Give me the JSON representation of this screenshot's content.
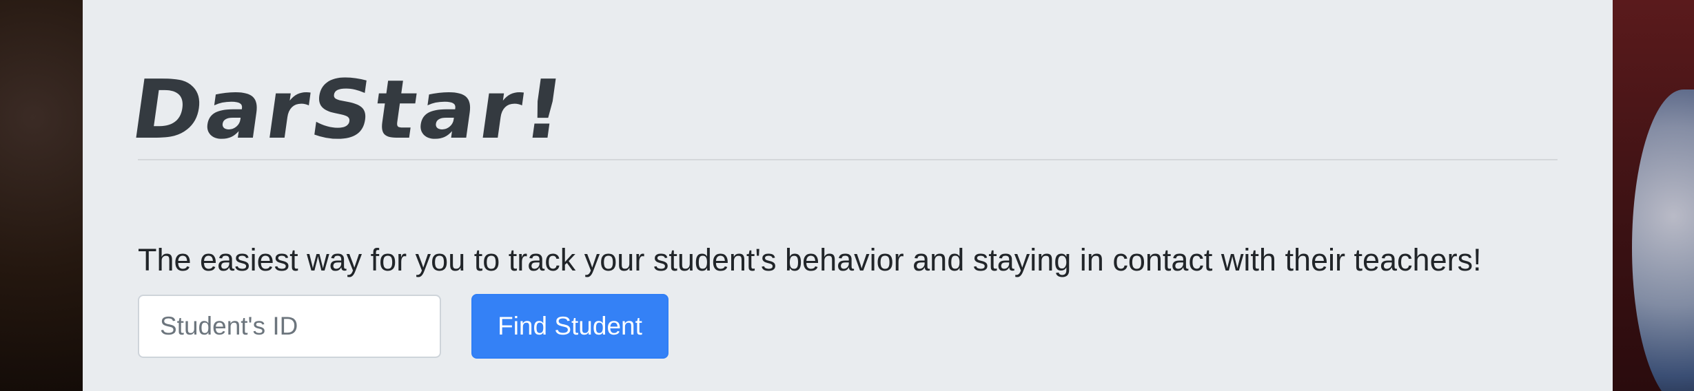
{
  "brand": {
    "title": "DarStar!"
  },
  "hero": {
    "lead_text": "The easiest way for you to track your student's behavior and staying in contact with their teachers!"
  },
  "search": {
    "placeholder": "Student's ID",
    "value": "",
    "button_label": "Find Student"
  },
  "colors": {
    "jumbotron_bg": "#e9ecef",
    "brand_text": "#343a40",
    "button_bg": "#3481f6",
    "button_text": "#ffffff"
  }
}
